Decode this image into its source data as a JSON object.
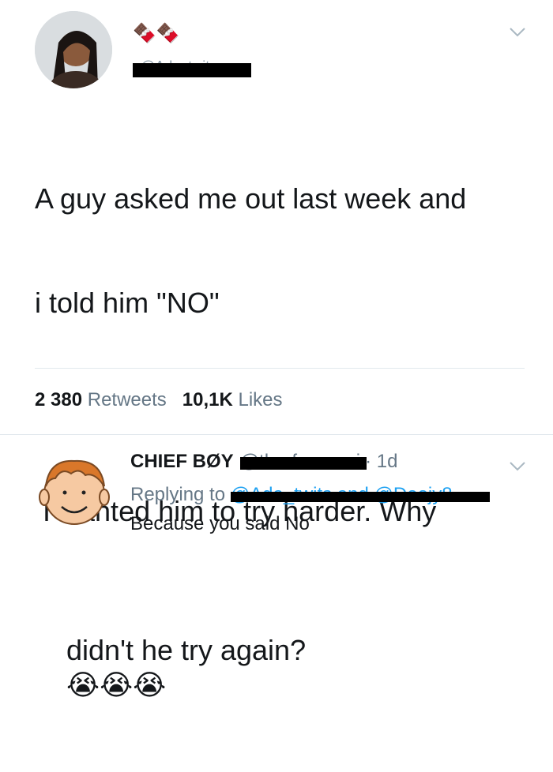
{
  "tweet": {
    "emoji_name": "🍫🍫",
    "handle": "@Ada_twits",
    "text_line1": "A guy asked me out last week and",
    "text_line2": "i told him \"NO\"",
    "text_line3": " I wanted him to try harder. Why",
    "text_line4": "didn't he try again?",
    "emojis": "😭😭😭",
    "retweets_count": "2 380",
    "retweets_label": "Retweets",
    "likes_count": "10,1K",
    "likes_label": "Likes"
  },
  "reply": {
    "name": "CHIEF BØY",
    "handle": "@therforeanni",
    "time": "· 1d",
    "replying_label": "Replying to",
    "replying_handles": "@Ada_twits and @Deejy8",
    "text": "Because you said No"
  },
  "icons": {
    "avatar": "profile-photo",
    "reply_avatar": "cartoon-boy-face",
    "chevron": "chevron-down-icon"
  },
  "colors": {
    "text": "#14171a",
    "muted": "#657786",
    "link": "#1da1f2",
    "divider": "#e1e8ed",
    "redaction": "#000000"
  }
}
